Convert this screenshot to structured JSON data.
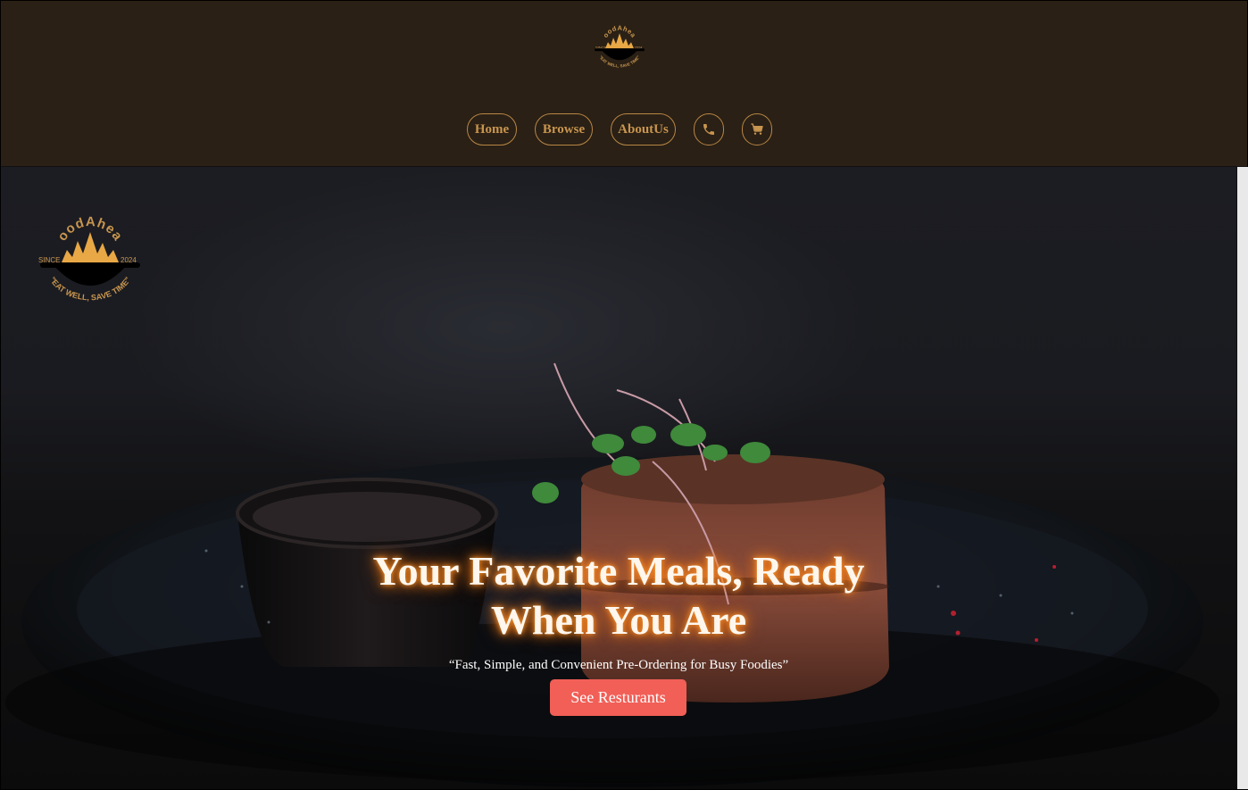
{
  "brand": {
    "name": "FoodAhead",
    "since_left": "SINCE",
    "since_right": "2024",
    "tagline": "\"EAT WELL, SAVE TIME\"",
    "colors": {
      "gold": "#c8954f",
      "flame": "#e8a845",
      "header_bg": "#2a2015"
    }
  },
  "nav": {
    "home": "Home",
    "browse": "Browse",
    "about": "AboutUs",
    "phone_icon": "phone-icon",
    "cart_icon": "cart-icon"
  },
  "hero": {
    "title_line1": "Your Favorite Meals, Ready",
    "title_line2": "When You Are",
    "subtitle": "“Fast, Simple, and Convenient Pre-Ordering for Busy Foodies”",
    "cta_label": "See Resturants",
    "cta_color": "#f15f57",
    "background_image": "steak-on-dark-plate-with-microgreens-and-sauce-cup"
  }
}
